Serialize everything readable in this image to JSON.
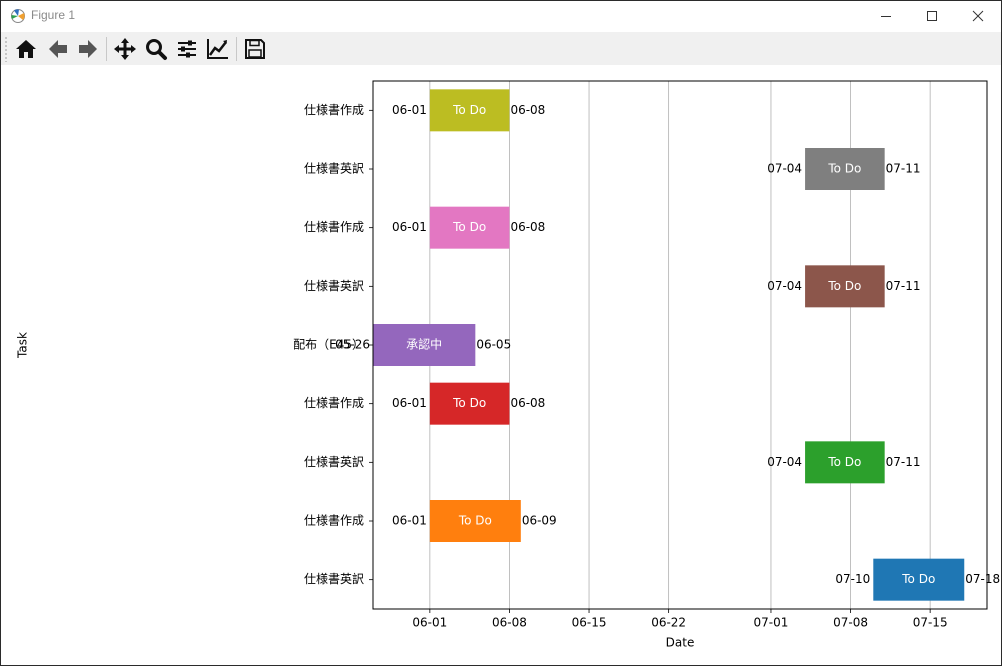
{
  "window": {
    "title": "Figure 1",
    "minimize_icon": "minimize-icon",
    "maximize_icon": "maximize-icon",
    "close_icon": "close-icon"
  },
  "toolbar": {
    "buttons": [
      {
        "name": "home-button",
        "icon": "home-icon"
      },
      {
        "name": "back-button",
        "icon": "arrow-left-icon"
      },
      {
        "name": "forward-button",
        "icon": "arrow-right-icon"
      },
      {
        "name": "pan-button",
        "icon": "move-icon"
      },
      {
        "name": "zoom-button",
        "icon": "zoom-icon"
      },
      {
        "name": "subplots-button",
        "icon": "sliders-icon"
      },
      {
        "name": "edit-axis-button",
        "icon": "line-chart-icon"
      },
      {
        "name": "save-button",
        "icon": "save-icon"
      }
    ]
  },
  "chart_data": {
    "type": "bar",
    "orientation": "horizontal",
    "title": "",
    "xlabel": "Date",
    "ylabel": "Task",
    "xlim": [
      "2024-05-27",
      "2024-07-20"
    ],
    "x_ticks": [
      "06-01",
      "06-08",
      "06-15",
      "06-22",
      "07-01",
      "07-08",
      "07-15"
    ],
    "x_tick_dates": [
      "2024-06-01",
      "2024-06-08",
      "2024-06-15",
      "2024-06-22",
      "2024-07-01",
      "2024-07-08",
      "2024-07-15"
    ],
    "grid": "x",
    "tasks": [
      {
        "label": "仕様書作成",
        "start": "2024-06-01",
        "end": "2024-06-08",
        "start_label": "06-01",
        "end_label": "06-08",
        "status": "To Do",
        "color": "#bcbd22"
      },
      {
        "label": "仕様書英訳",
        "start": "2024-07-04",
        "end": "2024-07-11",
        "start_label": "07-04",
        "end_label": "07-11",
        "status": "To Do",
        "color": "#7f7f7f"
      },
      {
        "label": "仕様書作成",
        "start": "2024-06-01",
        "end": "2024-06-08",
        "start_label": "06-01",
        "end_label": "06-08",
        "status": "To Do",
        "color": "#e377c2"
      },
      {
        "label": "仕様書英訳",
        "start": "2024-07-04",
        "end": "2024-07-11",
        "start_label": "07-04",
        "end_label": "07-11",
        "status": "To Do",
        "color": "#8c564b"
      },
      {
        "label": "配布（E45）",
        "start": "2024-05-26",
        "end": "2024-06-05",
        "start_label": "05-26",
        "end_label": "06-05",
        "status": "承認中",
        "color": "#9467bd"
      },
      {
        "label": "仕様書作成",
        "start": "2024-06-01",
        "end": "2024-06-08",
        "start_label": "06-01",
        "end_label": "06-08",
        "status": "To Do",
        "color": "#d62728"
      },
      {
        "label": "仕様書英訳",
        "start": "2024-07-04",
        "end": "2024-07-11",
        "start_label": "07-04",
        "end_label": "07-11",
        "status": "To Do",
        "color": "#2ca02c"
      },
      {
        "label": "仕様書作成",
        "start": "2024-06-01",
        "end": "2024-06-09",
        "start_label": "06-01",
        "end_label": "06-09",
        "status": "To Do",
        "color": "#ff7f0e"
      },
      {
        "label": "仕様書英訳",
        "start": "2024-07-10",
        "end": "2024-07-18",
        "start_label": "07-10",
        "end_label": "07-18",
        "status": "To Do",
        "color": "#1f77b4"
      }
    ]
  }
}
